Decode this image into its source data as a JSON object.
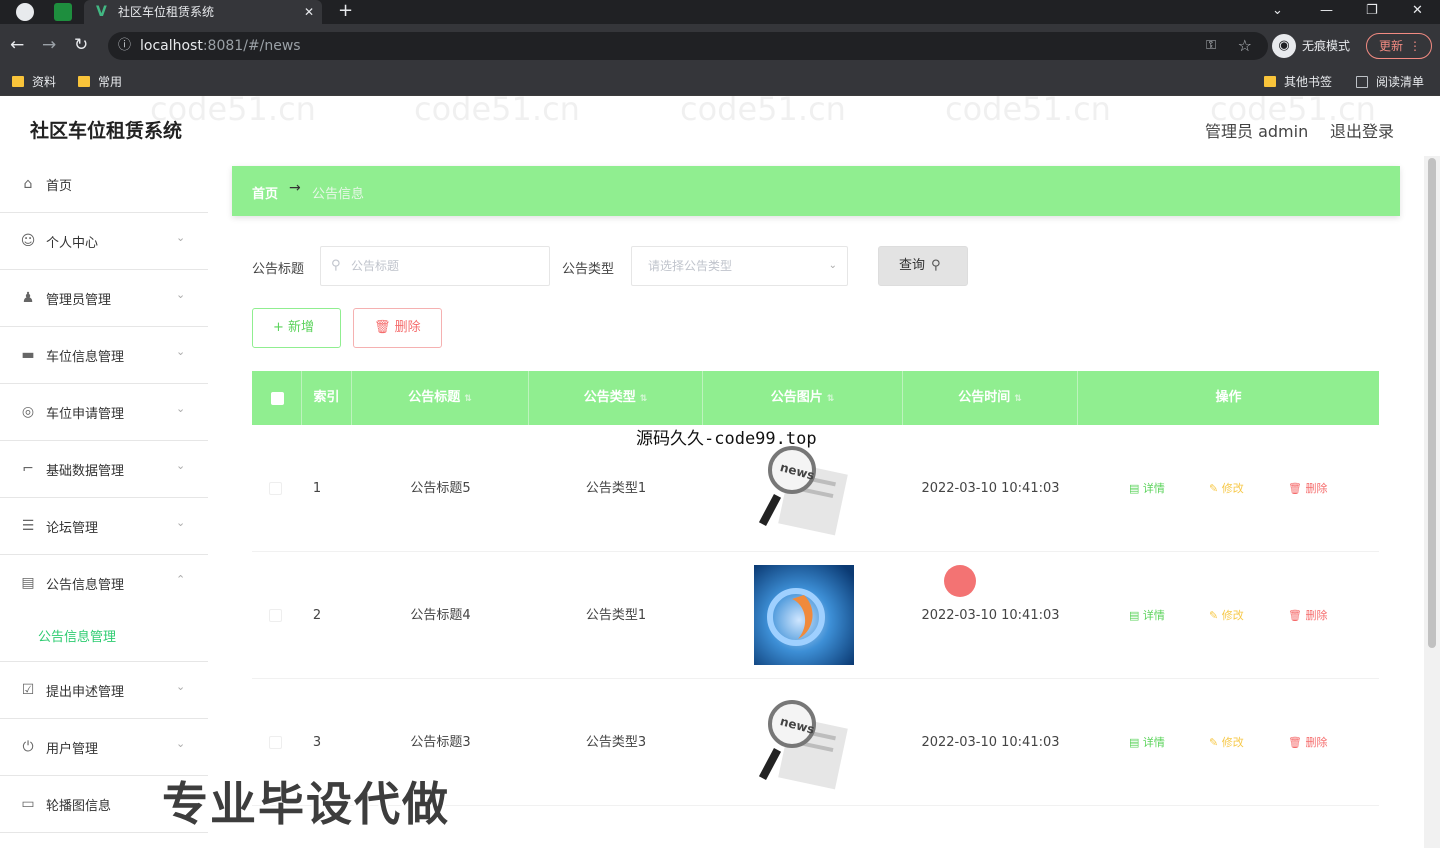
{
  "browser": {
    "tab_title": "社区车位租赁系统",
    "url_host": "localhost",
    "url_rest": ":8081/#/news",
    "incognito_label": "无痕模式",
    "update_label": "更新",
    "bookmarks": [
      "资料",
      "常用"
    ],
    "bookmarks_right": [
      "其他书签",
      "阅读清单"
    ]
  },
  "app": {
    "title": "社区车位租赁系统",
    "admin_label": "管理员 admin",
    "logout_label": "退出登录"
  },
  "sidebar": {
    "items": [
      {
        "label": "首页",
        "icon": "home-icon"
      },
      {
        "label": "个人中心",
        "icon": "user-icon"
      },
      {
        "label": "管理员管理",
        "icon": "admin-icon"
      },
      {
        "label": "车位信息管理",
        "icon": "parking-icon"
      },
      {
        "label": "车位申请管理",
        "icon": "compass-icon"
      },
      {
        "label": "基础数据管理",
        "icon": "crop-icon"
      },
      {
        "label": "论坛管理",
        "icon": "sliders-icon"
      },
      {
        "label": "公告信息管理",
        "icon": "chat-icon"
      },
      {
        "label": "提出申述管理",
        "icon": "check-icon"
      },
      {
        "label": "用户管理",
        "icon": "power-icon"
      },
      {
        "label": "轮播图信息",
        "icon": "message-icon"
      }
    ],
    "submenu_active": "公告信息管理"
  },
  "breadcrumb": {
    "home": "首页",
    "current": "公告信息"
  },
  "search": {
    "title_label": "公告标题",
    "title_placeholder": "公告标题",
    "type_label": "公告类型",
    "type_placeholder": "请选择公告类型",
    "query_label": "查询"
  },
  "actions": {
    "add_label": "新增",
    "delete_label": "删除"
  },
  "table": {
    "headers": [
      "索引",
      "公告标题",
      "公告类型",
      "公告图片",
      "公告时间",
      "操作"
    ],
    "rows": [
      {
        "index": "1",
        "title": "公告标题5",
        "type": "公告类型1",
        "time": "2022-03-10 10:41:03",
        "image": "news-magnifier"
      },
      {
        "index": "2",
        "title": "公告标题4",
        "type": "公告类型1",
        "time": "2022-03-10 10:41:03",
        "image": "blue-abstract"
      },
      {
        "index": "3",
        "title": "公告标题3",
        "type": "公告类型3",
        "time": "2022-03-10 10:41:03",
        "image": "news-magnifier"
      }
    ],
    "row_actions": {
      "detail": "详情",
      "edit": "修改",
      "delete": "删除"
    }
  },
  "overlays": {
    "top": "源码久久-code99.top",
    "bottom": "专业毕设代做",
    "watermark": "code51.cn"
  },
  "colors": {
    "accent": "#90ee90",
    "detail": "#5bd35b",
    "edit": "#f7c94a",
    "danger": "#f56c6c"
  }
}
